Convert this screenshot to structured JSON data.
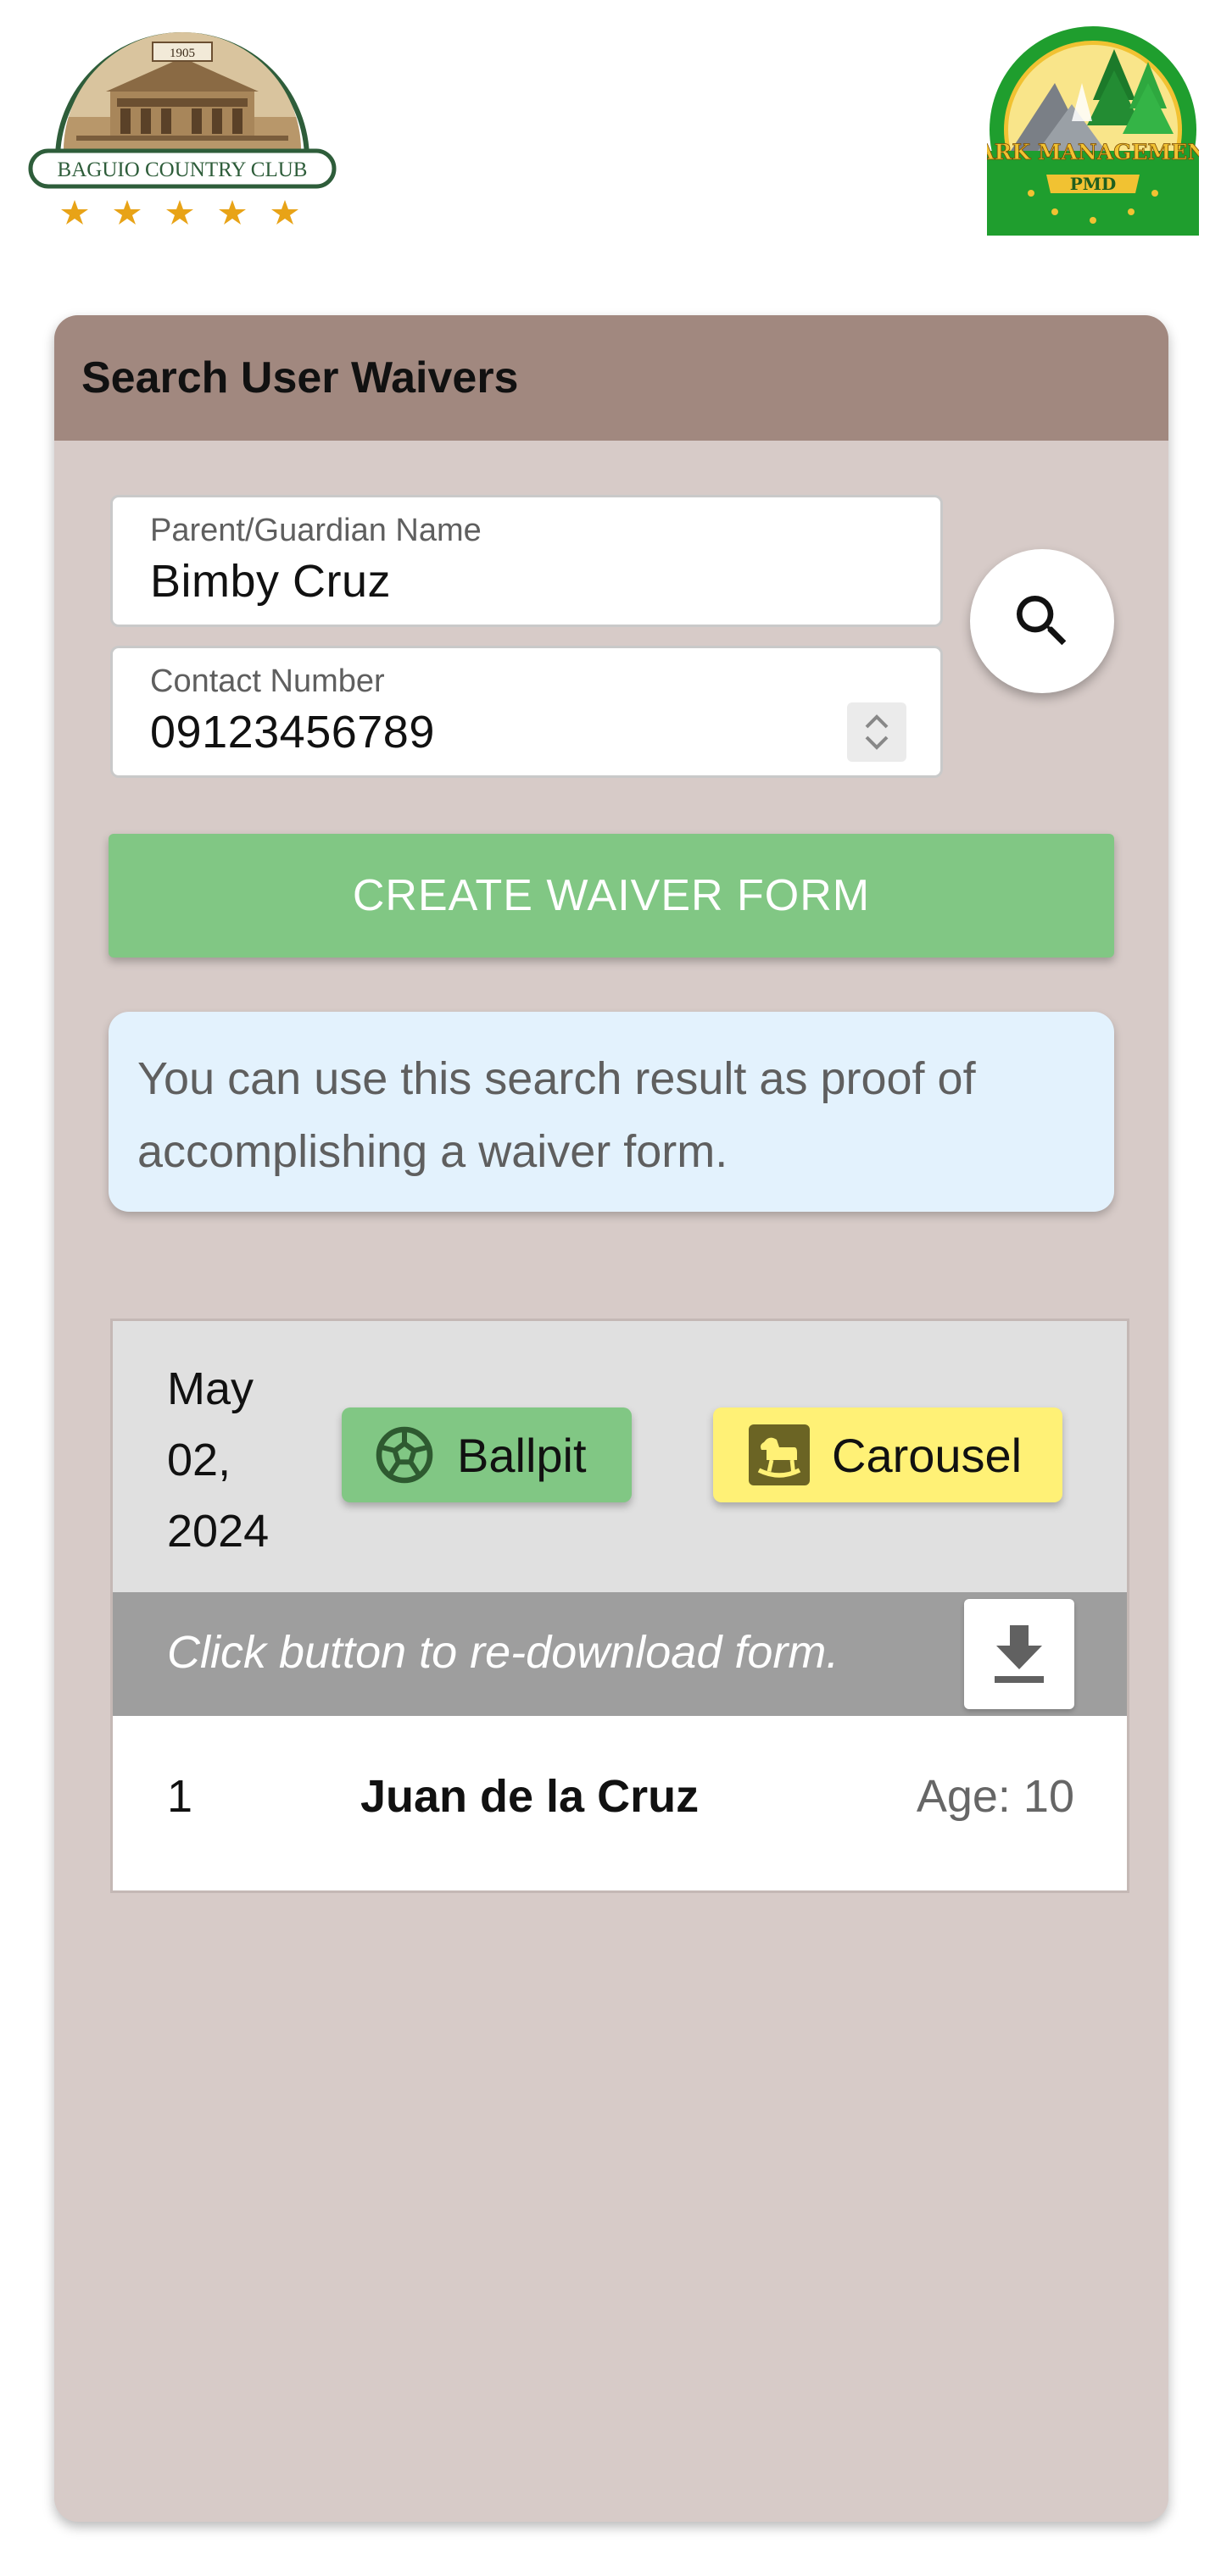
{
  "header": {
    "left_logo": {
      "year": "1905",
      "name": "BAGUIO COUNTRY CLUB",
      "stars": 5
    },
    "right_logo": {
      "line1": "PARK MANAGEMENT",
      "line2": "PMD"
    }
  },
  "card": {
    "title": "Search User Waivers"
  },
  "search": {
    "guardian_label": "Parent/Guardian Name",
    "guardian_value": "Bimby Cruz",
    "contact_label": "Contact Number",
    "contact_value": "09123456789",
    "search_icon": "search-icon"
  },
  "actions": {
    "create_label": "CREATE WAIVER FORM"
  },
  "info": {
    "text": "You can use this search result as proof of accomplishing a waiver form."
  },
  "result": {
    "date_line1": "May",
    "date_line2": "02,",
    "date_line3": "2024",
    "attractions": [
      {
        "label": "Ballpit",
        "icon": "soccer-ball-icon",
        "color": "#81c784"
      },
      {
        "label": "Carousel",
        "icon": "rocking-horse-icon",
        "color": "#fff176"
      }
    ],
    "redownload_text": "Click button to re-download form.",
    "download_icon": "download-icon",
    "entries": [
      {
        "number": "1",
        "name": "Juan de la Cruz",
        "age": "Age: 10"
      }
    ]
  },
  "colors": {
    "card_header": "#a1887f",
    "card_body": "#d7cbc8",
    "create_button": "#81c784",
    "info_box": "#e3f2fd",
    "result_bar": "#9e9e9e"
  }
}
